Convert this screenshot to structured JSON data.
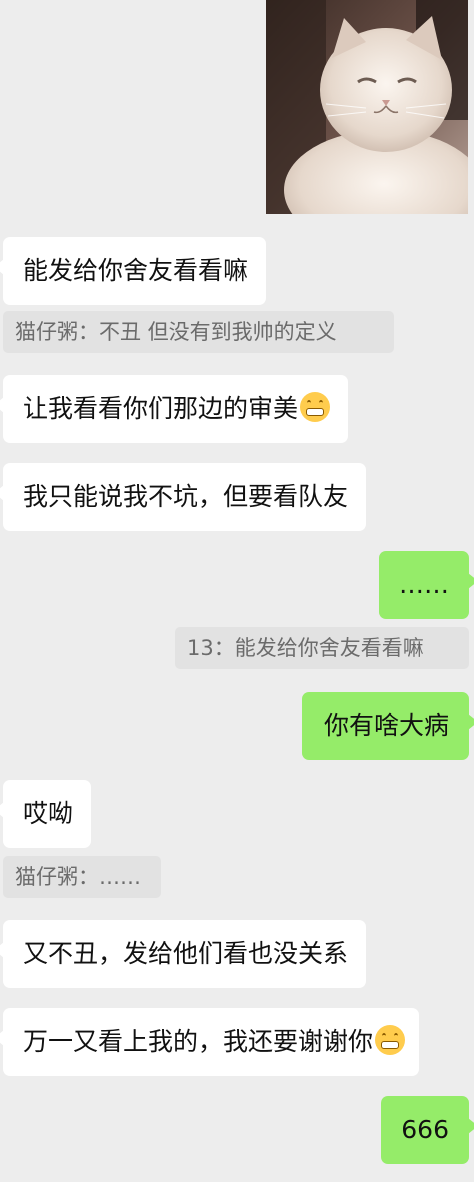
{
  "messages": [
    {
      "side": "left",
      "text": "能发给你舍友看看嘛"
    },
    {
      "quote": "猫仔粥：不丑 但没有到我帅的定义"
    },
    {
      "side": "left",
      "text": "让我看看你们那边的审美",
      "emoji": "grimacing-emoji"
    },
    {
      "side": "left",
      "text": "我只能说我不坑，但要看队友"
    },
    {
      "side": "right",
      "text": "……"
    },
    {
      "quote": "13：能发给你舍友看看嘛"
    },
    {
      "side": "right",
      "text": "你有啥大病"
    },
    {
      "side": "left",
      "text": "哎呦"
    },
    {
      "quote": "猫仔粥：……"
    },
    {
      "side": "left",
      "text": "又不丑，发给他们看也没关系"
    },
    {
      "side": "left",
      "text": "万一又看上我的，我还要谢谢你",
      "emoji": "grimacing-emoji"
    },
    {
      "side": "right",
      "text": "666"
    }
  ],
  "photo": {
    "icon": "cat-photo"
  }
}
